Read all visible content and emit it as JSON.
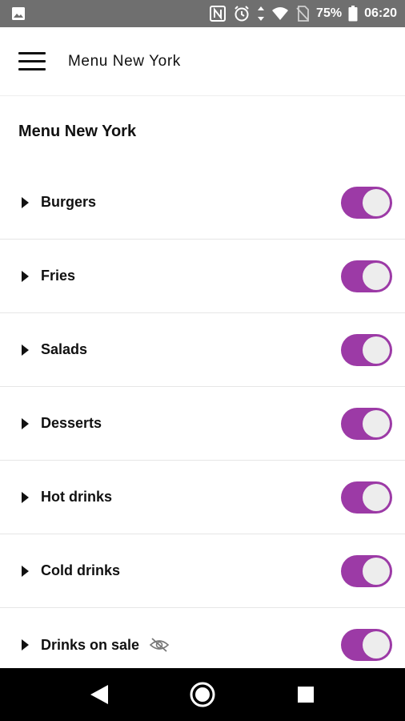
{
  "status_bar": {
    "battery": "75%",
    "time": "06:20",
    "icons": [
      "image-icon",
      "nfc-icon",
      "alarm-icon",
      "data-arrows-icon",
      "wifi-icon",
      "no-sim-icon",
      "battery-icon"
    ]
  },
  "app_bar": {
    "title": "Menu New York",
    "menu_icon": "hamburger-menu-icon"
  },
  "section": {
    "title": "Menu New York"
  },
  "menu_items": [
    {
      "label": "Burgers",
      "enabled": true
    },
    {
      "label": "Fries",
      "enabled": true
    },
    {
      "label": "Salads",
      "enabled": true
    },
    {
      "label": "Desserts",
      "enabled": true
    },
    {
      "label": "Hot drinks",
      "enabled": true
    },
    {
      "label": "Cold drinks",
      "enabled": true
    },
    {
      "label": "Drinks on sale",
      "enabled": true,
      "icon": "eye-off-icon"
    }
  ],
  "colors": {
    "accent": "#9c3aa6",
    "status_bar": "#6f6f6f",
    "nav_bar": "#000000"
  },
  "nav_bar": {
    "icons": [
      "back-icon",
      "home-icon",
      "recents-icon"
    ]
  }
}
